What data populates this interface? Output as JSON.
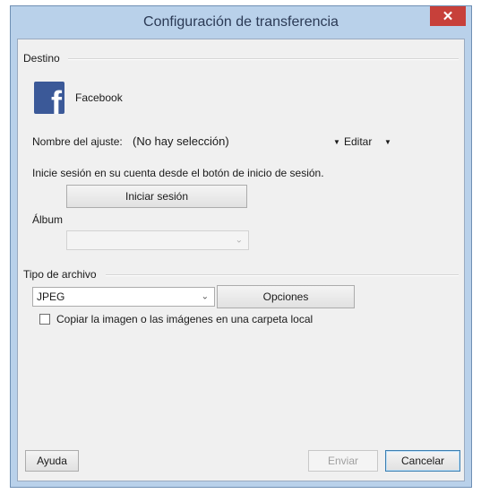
{
  "dialog": {
    "title": "Configuración de transferencia",
    "close_glyph": "✕"
  },
  "destino": {
    "section_label": "Destino",
    "service_icon": "facebook-logo",
    "service_name": "Facebook",
    "setting_label": "Nombre del ajuste:",
    "setting_value": "(No hay selección)",
    "edit_label": "Editar",
    "login_hint": "Inicie sesión en su cuenta desde el botón de inicio de sesión.",
    "login_button": "Iniciar sesión",
    "album_label": "Álbum",
    "album_value": ""
  },
  "file_type": {
    "section_label": "Tipo de archivo",
    "selected": "JPEG",
    "options_button": "Opciones",
    "copy_local_label": "Copiar la imagen o las imágenes en una carpeta local",
    "copy_local_checked": false
  },
  "footer": {
    "help_button": "Ayuda",
    "send_button": "Enviar",
    "cancel_button": "Cancelar"
  },
  "colors": {
    "titlebar": "#b9d1ea",
    "close_button": "#c7403a",
    "facebook_blue": "#3b5998",
    "client_bg": "#f0f0f0"
  }
}
